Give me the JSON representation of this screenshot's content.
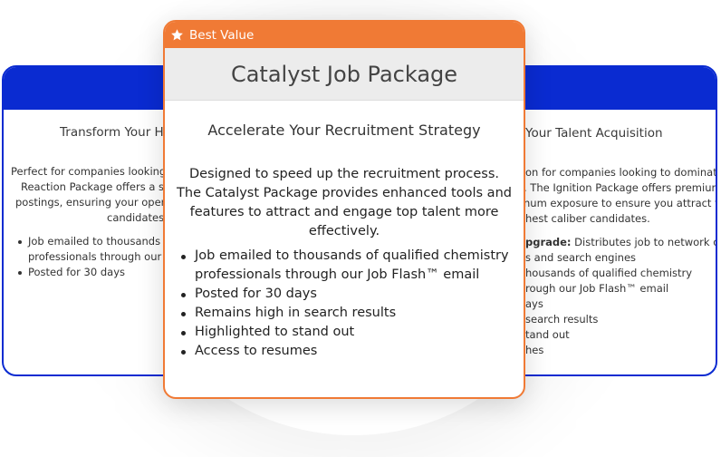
{
  "colors": {
    "side_accent": "#0a2bd1",
    "featured_accent": "#f07a35",
    "featured_title_bg": "#ececec"
  },
  "left_card": {
    "subtitle": "Transform Your H",
    "description_lines": [
      "Perfect for companies looking to",
      "Reaction Package offers a stre",
      "postings, ensuring your opening",
      "candidates s"
    ],
    "features": [
      [
        "Job emailed to thousands of",
        "professionals through our Jo"
      ],
      [
        "Posted for 30 days"
      ]
    ]
  },
  "featured_card": {
    "badge_icon": "star-icon",
    "badge": "Best Value",
    "title": "Catalyst Job Package",
    "subtitle": "Accelerate Your Recruitment Strategy",
    "description": "Designed to speed up the recruitment process. The Catalyst Package provides enhanced tools and features to attract and engage top talent more effectively.",
    "features": [
      "Job emailed to thousands of qualified chemistry professionals through our Job Flash™ email",
      "Posted for 30 days",
      "Remains high in search results",
      "Highlighted to stand out",
      "Access to resumes"
    ]
  },
  "right_card": {
    "subtitle": "Your Talent Acquisition",
    "description_lines": [
      "on for companies looking to dominate",
      ". The Ignition Package offers premium",
      "num exposure to ensure you attract the",
      "hest caliber candidates."
    ],
    "upgrade_label": "pgrade:",
    "feature_lines": [
      " Distributes job to network of",
      "s and search engines",
      "housands of qualified chemistry",
      "rough our Job Flash™ email",
      "ays",
      "search results",
      "tand out",
      "hes"
    ]
  }
}
